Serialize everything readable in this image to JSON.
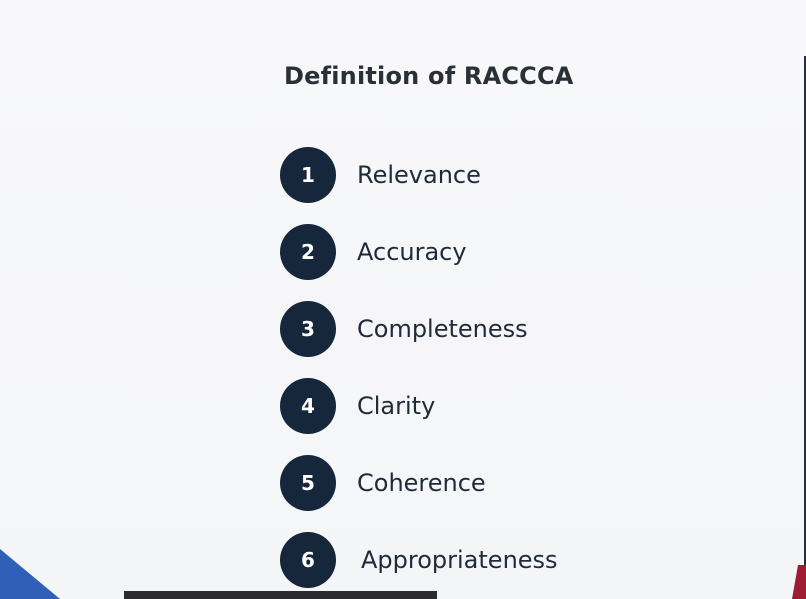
{
  "slide": {
    "title": "Definition of RACCCA",
    "items": [
      {
        "number": "1",
        "label": "Relevance"
      },
      {
        "number": "2",
        "label": "Accuracy"
      },
      {
        "number": "3",
        "label": "Completeness"
      },
      {
        "number": "4",
        "label": "Clarity"
      },
      {
        "number": "5",
        "label": "Coherence"
      },
      {
        "number": "6",
        "label": "Appropriateness"
      }
    ]
  },
  "colors": {
    "badge": "#16263b",
    "text": "#1f2a3a",
    "title": "#2b2f38",
    "background": "#f7f7f9",
    "accent_blue": "#2f5fb7",
    "accent_red": "#9e1b32"
  }
}
